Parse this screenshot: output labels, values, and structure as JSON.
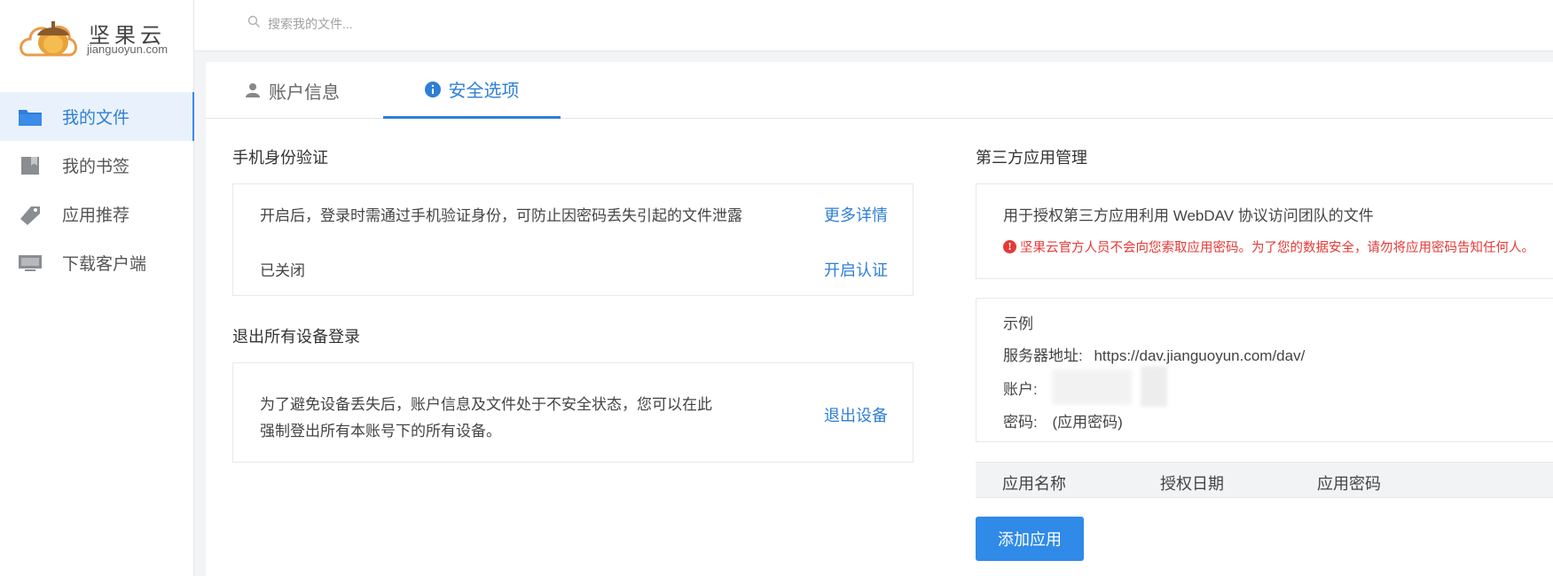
{
  "logo": {
    "cn": "坚果云",
    "en": "jianguoyun.com"
  },
  "sidebar": {
    "items": [
      {
        "label": "我的文件",
        "icon": "folder-icon"
      },
      {
        "label": "我的书签",
        "icon": "bookmark-icon"
      },
      {
        "label": "应用推荐",
        "icon": "tag-icon"
      },
      {
        "label": "下载客户端",
        "icon": "monitor-icon"
      }
    ]
  },
  "search": {
    "placeholder": "搜索我的文件..."
  },
  "tabs": [
    {
      "label": "账户信息",
      "icon": "user-icon"
    },
    {
      "label": "安全选项",
      "icon": "info-icon"
    }
  ],
  "phone_verify": {
    "title": "手机身份验证",
    "desc": "开启后，登录时需通过手机验证身份，可防止因密码丢失引起的文件泄露",
    "more_link": "更多详情",
    "status": "已关闭",
    "enable_link": "开启认证"
  },
  "logout_all": {
    "title": "退出所有设备登录",
    "desc_line1": "为了避免设备丢失后，账户信息及文件处于不安全状态，您可以在此",
    "desc_line2": "强制登出所有本账号下的所有设备。",
    "logout_link": "退出设备"
  },
  "third_party": {
    "title": "第三方应用管理",
    "desc": "用于授权第三方应用利用 WebDAV 协议访问团队的文件",
    "warning": "坚果云官方人员不会向您索取应用密码。为了您的数据安全，请勿将应用密码告知任何人。"
  },
  "example": {
    "title": "示例",
    "server_label": "服务器地址:",
    "server_value": "https://dav.jianguoyun.com/dav/",
    "account_label": "账户:",
    "password_label": "密码:",
    "password_value": "(应用密码)"
  },
  "app_table": {
    "columns": [
      "应用名称",
      "授权日期",
      "应用密码"
    ]
  },
  "add_app_button": "添加应用",
  "colors": {
    "accent": "#2f7fd6",
    "warning": "#e53935",
    "button": "#2f8ae8"
  }
}
